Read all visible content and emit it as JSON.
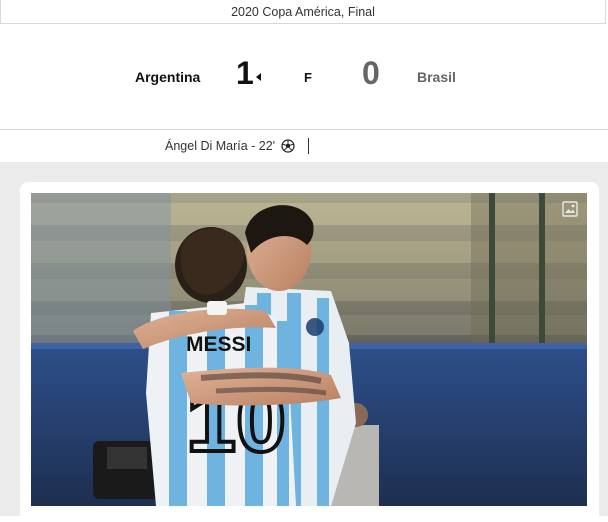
{
  "match": {
    "competition": "2020 Copa América, Final",
    "home_team": "Argentina",
    "home_score": "1",
    "status": "F",
    "away_score": "0",
    "away_team": "Brasil"
  },
  "scorers": [
    {
      "text": "Ángel Di María - 22'",
      "icon": "soccer-ball-icon"
    }
  ],
  "photo": {
    "jersey_name": "MESSI",
    "jersey_number": "10",
    "icon": "image-icon"
  },
  "colors": {
    "border": "#d8d8d8",
    "background_gap": "#ececec",
    "home_text": "#111111",
    "away_text": "#666666",
    "jersey_blue": "#6fb3e0"
  }
}
